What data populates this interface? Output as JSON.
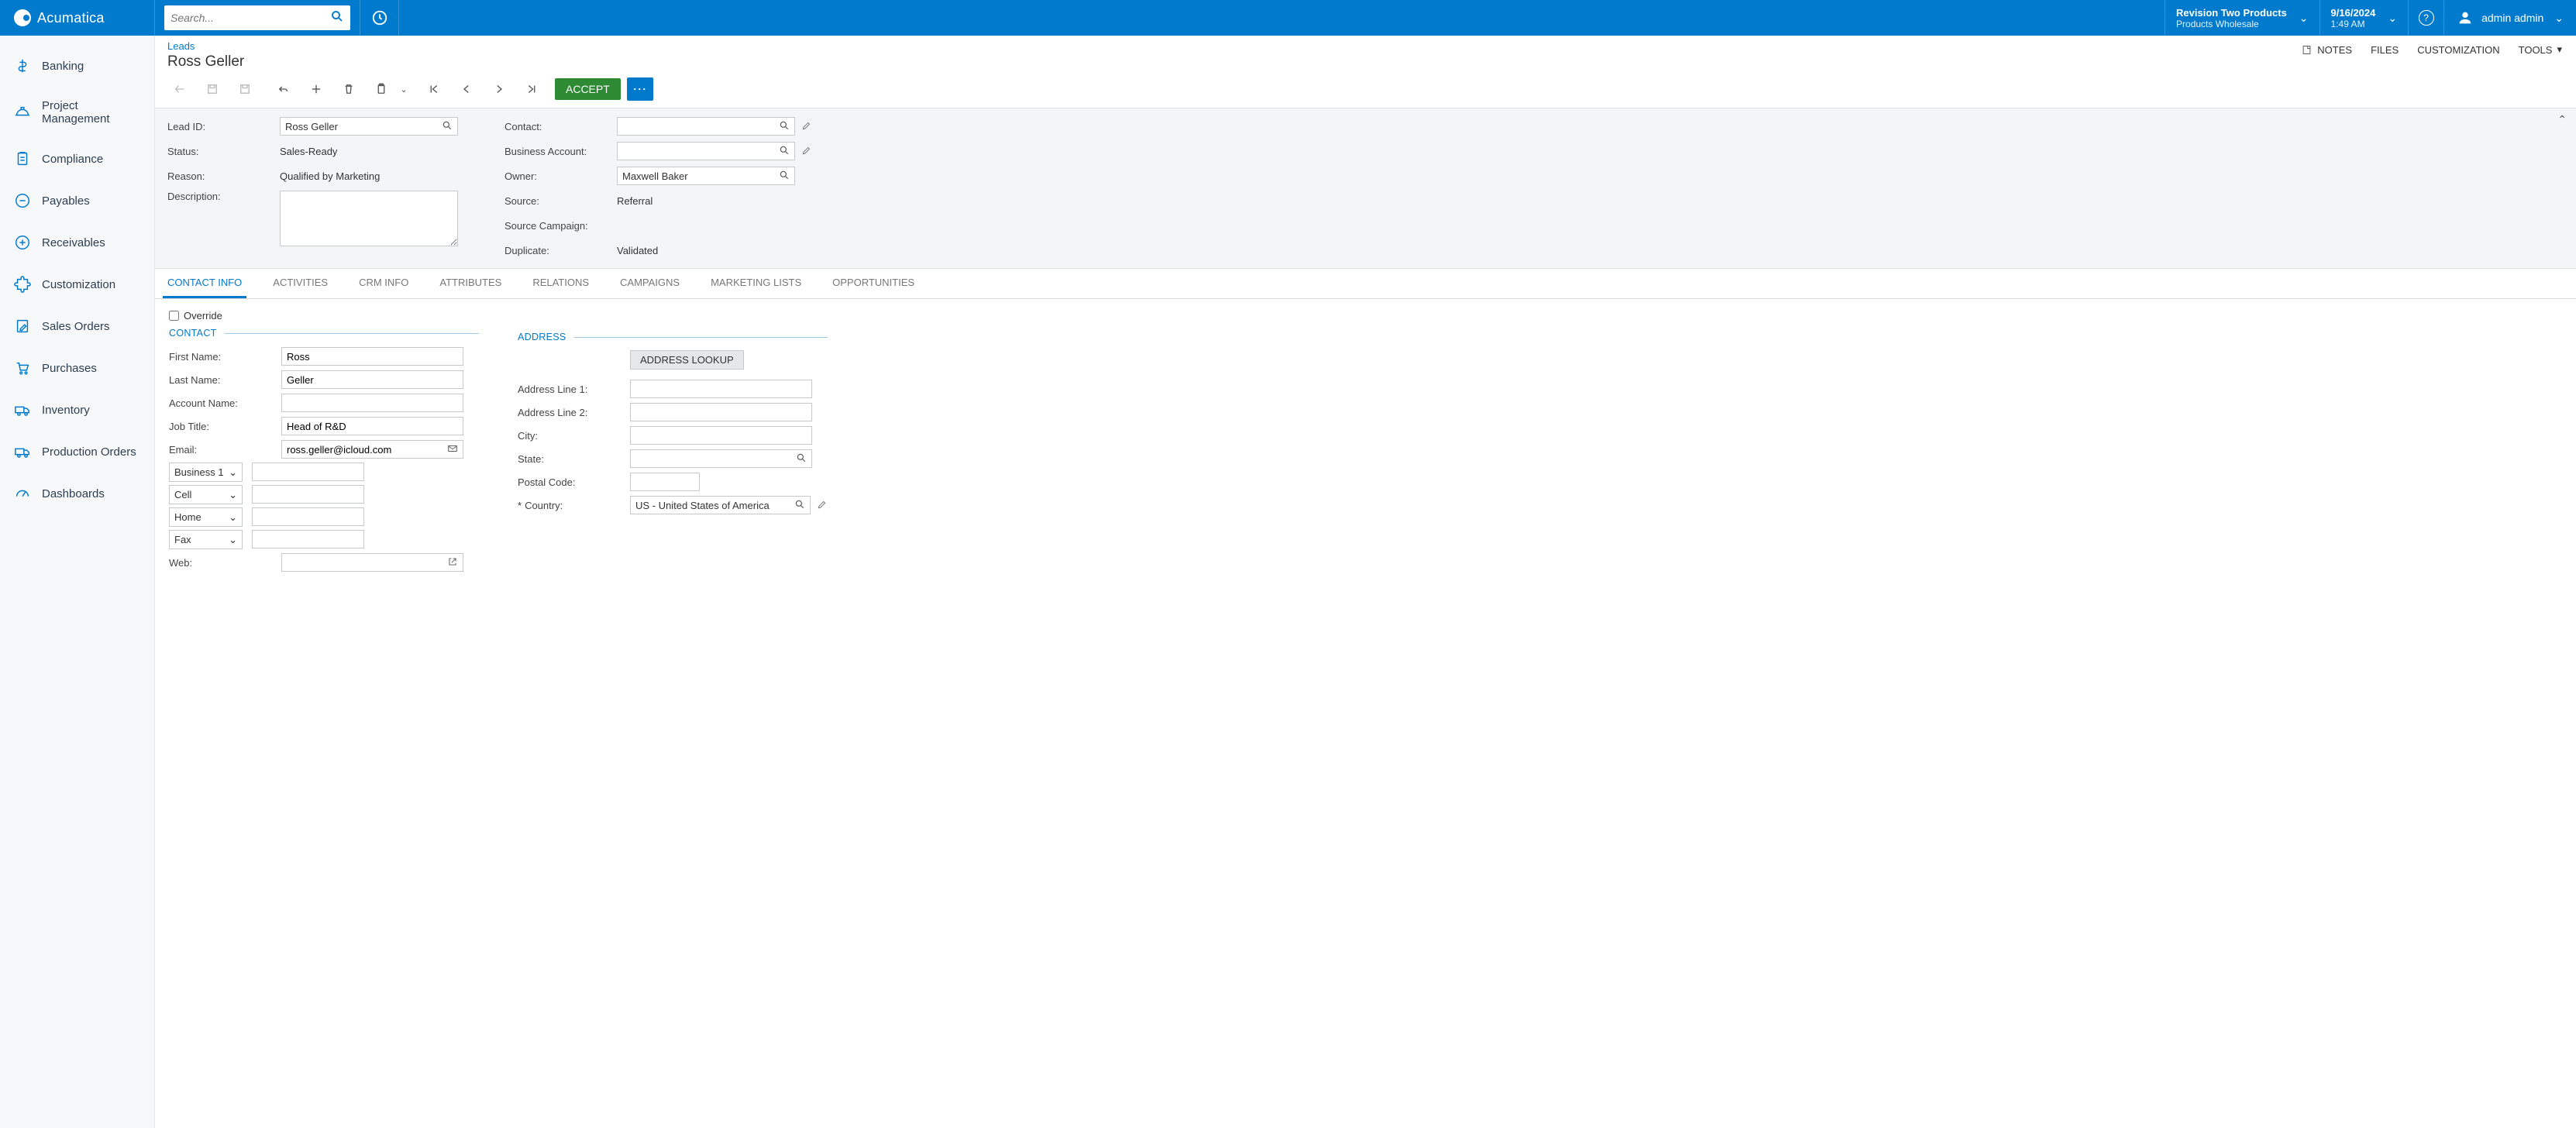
{
  "brand": "Acumatica",
  "search_placeholder": "Search...",
  "tenant": {
    "line1": "Revision Two Products",
    "line2": "Products Wholesale"
  },
  "datetime": {
    "date": "9/16/2024",
    "time": "1:49 AM"
  },
  "user": {
    "name": "admin admin"
  },
  "sidebar": {
    "items": [
      {
        "label": "Banking",
        "icon": "dollar"
      },
      {
        "label": "Project Management",
        "icon": "hardhat"
      },
      {
        "label": "Compliance",
        "icon": "clipboard"
      },
      {
        "label": "Payables",
        "icon": "minus-circle"
      },
      {
        "label": "Receivables",
        "icon": "plus-circle"
      },
      {
        "label": "Customization",
        "icon": "puzzle"
      },
      {
        "label": "Sales Orders",
        "icon": "edit-doc"
      },
      {
        "label": "Purchases",
        "icon": "cart"
      },
      {
        "label": "Inventory",
        "icon": "truck"
      },
      {
        "label": "Production Orders",
        "icon": "truck"
      },
      {
        "label": "Dashboards",
        "icon": "gauge"
      }
    ]
  },
  "breadcrumb": "Leads",
  "title": "Ross Geller",
  "page_actions": {
    "notes": "NOTES",
    "files": "FILES",
    "customization": "CUSTOMIZATION",
    "tools": "TOOLS"
  },
  "toolbar": {
    "accept": "ACCEPT"
  },
  "summary": {
    "lead_id_label": "Lead ID:",
    "lead_id_value": "Ross Geller",
    "status_label": "Status:",
    "status_value": "Sales-Ready",
    "reason_label": "Reason:",
    "reason_value": "Qualified by Marketing",
    "description_label": "Description:",
    "description_value": "",
    "contact_label": "Contact:",
    "contact_value": "",
    "account_label": "Business Account:",
    "account_value": "",
    "owner_label": "Owner:",
    "owner_value": "Maxwell Baker",
    "source_label": "Source:",
    "source_value": "Referral",
    "campaign_label": "Source Campaign:",
    "campaign_value": "",
    "duplicate_label": "Duplicate:",
    "duplicate_value": "Validated"
  },
  "tabs": [
    "CONTACT INFO",
    "ACTIVITIES",
    "CRM INFO",
    "ATTRIBUTES",
    "RELATIONS",
    "CAMPAIGNS",
    "MARKETING LISTS",
    "OPPORTUNITIES"
  ],
  "contact_tab": {
    "override_label": "Override",
    "contact_hdr": "CONTACT",
    "address_hdr": "ADDRESS",
    "first_name_label": "First Name:",
    "first_name": "Ross",
    "last_name_label": "Last Name:",
    "last_name": "Geller",
    "account_name_label": "Account Name:",
    "account_name": "",
    "job_title_label": "Job Title:",
    "job_title": "Head of R&D",
    "email_label": "Email:",
    "email": "ross.geller@icloud.com",
    "phone_types": [
      "Business 1",
      "Cell",
      "Home",
      "Fax"
    ],
    "web_label": "Web:",
    "web": "",
    "addr_lookup": "ADDRESS LOOKUP",
    "addr1_label": "Address Line 1:",
    "addr1": "",
    "addr2_label": "Address Line 2:",
    "addr2": "",
    "city_label": "City:",
    "city": "",
    "state_label": "State:",
    "state": "",
    "postal_label": "Postal Code:",
    "postal": "",
    "country_label": "Country:",
    "country": "US - United States of America"
  }
}
